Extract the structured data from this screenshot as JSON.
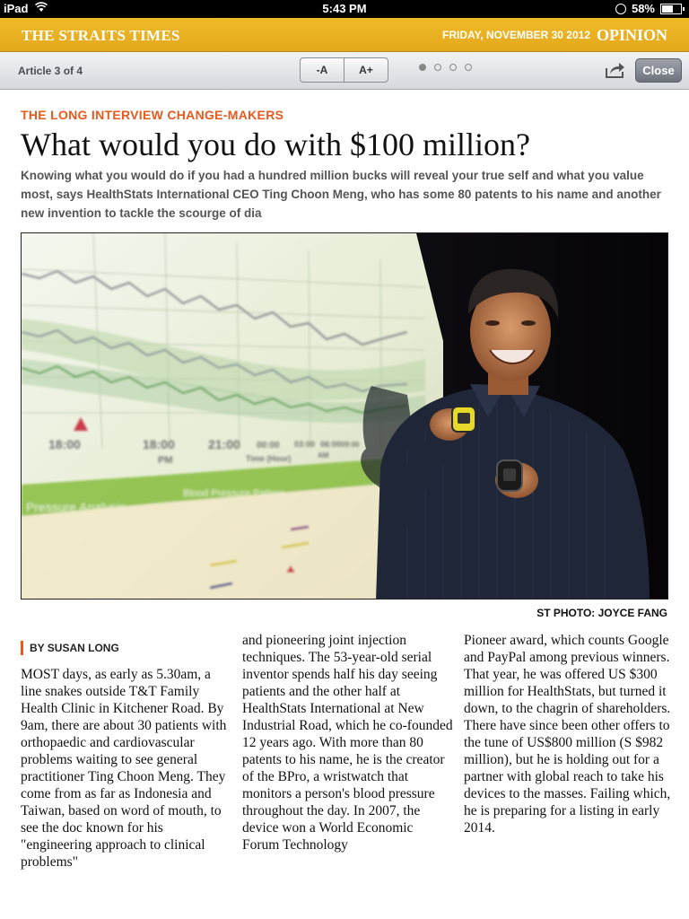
{
  "status_bar": {
    "device": "iPad",
    "time": "5:43 PM",
    "battery": "58%"
  },
  "masthead": {
    "logo": "THE STRAITS TIMES",
    "date": "FRIDAY, NOVEMBER 30 2012",
    "section": "OPINION"
  },
  "toolbar": {
    "article_count": "Article 3 of 4",
    "font_decrease": "-A",
    "font_increase": "A+",
    "close": "Close",
    "pages": 4,
    "current_page": 1
  },
  "article": {
    "kicker": "THE LONG INTERVIEW CHANGE-MAKERS",
    "headline": "What would you do with $100 million?",
    "standfirst": "Knowing what you would do if you had a hundred million bucks will reveal your true self and what you value most, says HealthStats International CEO Ting Choon Meng, who has some 80 patents to his name and another new invention to tackle the scourge of dia",
    "photo_credit": "ST PHOTO: JOYCE FANG",
    "byline": "BY SUSAN LONG",
    "col1": "MOST days, as early as 5.30am, a line snakes outside T&T Family Health Clinic in Kitchener Road. By 9am, there are about 30 patients with orthopaedic and cardiovascular problems waiting to see general practitioner Ting Choon Meng. They come from as far as Indonesia and Taiwan, based on word of mouth, to see the doc known for his \"engineering approach to clinical problems\"",
    "col2": "and pioneering joint injection techniques. The 53-year-old serial inventor spends half his day seeing patients and the other half at HealthStats International at New Industrial Road, which he co-founded 12 years ago. With more than 80 patents to his name, he is the creator of the BPro, a wristwatch that monitors a person's blood pressure throughout the day. In 2007, the device won a World Economic Forum Technology",
    "col3": "Pioneer award, which counts Google and PayPal among previous winners. That year, he was offered US $300 million for HealthStats, but turned it down, to the chagrin of shareholders. There have since been other offers to the tune of US$800 million (S $982 million), but he is holding out for a partner with global reach to take his devices to the masses. Failing which, he is preparing for a listing in early 2014.",
    "photo_chart_text": {
      "times": [
        "18:00",
        "18:00",
        "21:00",
        "00:00",
        "03:00",
        "06:00",
        "09:00"
      ],
      "pm": "PM",
      "am": "AM",
      "axis": "Time (Hour)",
      "band": "Blood Pressure Pattern",
      "panel": "Pressure Analysis"
    }
  }
}
